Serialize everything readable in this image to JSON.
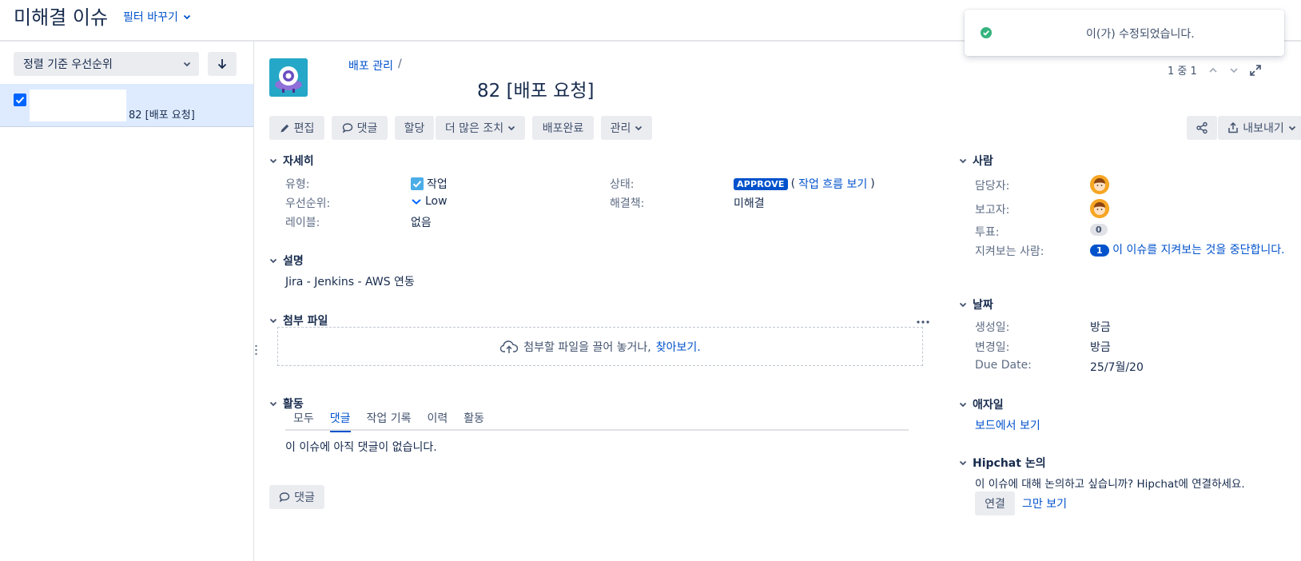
{
  "header": {
    "title": "미해결 이슈",
    "filter_switch": "필터 바꾸기"
  },
  "sidebar": {
    "sort_label": "정렬 기준 우선순위",
    "issue_summary": "82 [배포 요청]"
  },
  "issue": {
    "breadcrumb": "배포 관리",
    "breadcrumb_sep": "/",
    "title": "82 [배포 요청]",
    "pager": "1 중 1"
  },
  "toolbar": {
    "edit": "편집",
    "comment": "댓글",
    "assign": "할당",
    "more": "더 많은 조치",
    "deploy_done": "배포완료",
    "manage": "관리",
    "export": "내보내기"
  },
  "details": {
    "heading": "자세히",
    "type_label": "유형:",
    "type_value": "작업",
    "priority_label": "우선순위:",
    "priority_value": "Low",
    "labels_label": "레이블:",
    "labels_value": "없음",
    "status_label": "상태:",
    "status_value": "APPROVE",
    "workflow_link": "작업 흐름 보기",
    "resolution_label": "해결책:",
    "resolution_value": "미해결"
  },
  "description": {
    "heading": "설명",
    "text": "Jira - Jenkins - AWS 연동"
  },
  "attachments": {
    "heading": "첨부 파일",
    "drop_text": "첨부할 파일을 끌어 놓거나,",
    "browse": "찾아보기."
  },
  "activity": {
    "heading": "활동",
    "tabs": [
      "모두",
      "댓글",
      "작업 기록",
      "이력",
      "활동"
    ],
    "active_tab": "댓글",
    "empty": "이 이슈에 아직 댓글이 없습니다.",
    "comment_button": "댓글"
  },
  "people": {
    "heading": "사람",
    "assignee_label": "담당자:",
    "reporter_label": "보고자:",
    "votes_label": "투표:",
    "votes_value": "0",
    "watchers_label": "지켜보는 사람:",
    "watchers_count": "1",
    "watch_link": "이 이슈를 지켜보는 것을 중단합니다."
  },
  "dates": {
    "heading": "날짜",
    "created_label": "생성일:",
    "created_value": "방금",
    "updated_label": "변경일:",
    "updated_value": "방금",
    "due_label": "Due Date:",
    "due_value": "25/7월/20"
  },
  "agile": {
    "heading": "애자일",
    "board_link": "보드에서 보기"
  },
  "hipchat": {
    "heading": "Hipchat 논의",
    "text": "이 이슈에 대해 논의하고 싶습니까? Hipchat에 연결하세요.",
    "connect": "연결",
    "dismiss": "그만 보기"
  },
  "toast": {
    "message": "이(가) 수정되었습니다."
  },
  "colors": {
    "accent": "#0052cc",
    "success": "#36b37e",
    "selected_row": "#deebff"
  }
}
